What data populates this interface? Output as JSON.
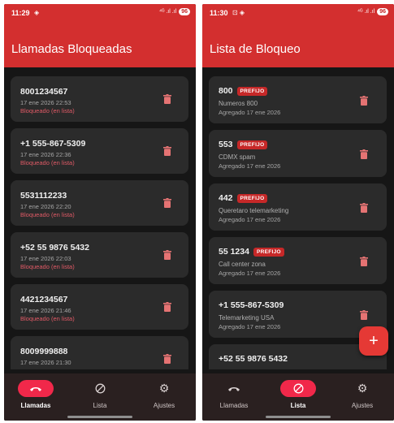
{
  "colors": {
    "header": "#d32f2f",
    "accent": "#f1284a",
    "background": "#161616",
    "card": "#2b2b2b",
    "status_red": "#e05a66"
  },
  "left": {
    "status": {
      "time": "11:29",
      "icons": "◈",
      "signal": "⁴ᴳ .ıl .ıl",
      "battery": "96"
    },
    "title": "Llamadas Bloqueadas",
    "calls": [
      {
        "number": "8001234567",
        "date": "17 ene 2026 22:53",
        "status": "Bloqueado (en lista)"
      },
      {
        "number": "+1 555-867-5309",
        "date": "17 ene 2026 22:36",
        "status": "Bloqueado (en lista)"
      },
      {
        "number": "5531112233",
        "date": "17 ene 2026 22:20",
        "status": "Bloqueado (en lista)"
      },
      {
        "number": "+52 55 9876 5432",
        "date": "17 ene 2026 22:03",
        "status": "Bloqueado (en lista)"
      },
      {
        "number": "4421234567",
        "date": "17 ene 2026 21:46",
        "status": "Bloqueado (en lista)"
      },
      {
        "number": "8009999888",
        "date": "17 ene 2026 21:30",
        "status": ""
      }
    ],
    "nav": [
      {
        "label": "Llamadas",
        "icon": "phone-hangup-icon"
      },
      {
        "label": "Lista",
        "icon": "block-icon"
      },
      {
        "label": "Ajustes",
        "icon": "gear-icon"
      }
    ],
    "nav_active": 0
  },
  "right": {
    "status": {
      "time": "11:30",
      "icons": "⊡ ◈",
      "signal": "⁴ᴳ .ıl .ıl",
      "battery": "96"
    },
    "title": "Lista de Bloqueo",
    "entries": [
      {
        "number": "800",
        "badge": "PREFIJO",
        "label": "Numeros 800",
        "added": "Agregado 17 ene 2026"
      },
      {
        "number": "553",
        "badge": "PREFIJO",
        "label": "CDMX spam",
        "added": "Agregado 17 ene 2026"
      },
      {
        "number": "442",
        "badge": "PREFIJO",
        "label": "Queretaro telemarketing",
        "added": "Agregado 17 ene 2026"
      },
      {
        "number": "55 1234",
        "badge": "PREFIJO",
        "label": "Call center zona",
        "added": "Agregado 17 ene 2026"
      },
      {
        "number": "+1 555-867-5309",
        "badge": "",
        "label": "Telemarketing USA",
        "added": "Agregado 17 ene 2026"
      },
      {
        "number": "+52 55 9876 5432",
        "badge": "",
        "label": "",
        "added": ""
      }
    ],
    "fab_label": "+",
    "nav": [
      {
        "label": "Llamadas",
        "icon": "phone-hangup-icon"
      },
      {
        "label": "Lista",
        "icon": "block-icon"
      },
      {
        "label": "Ajustes",
        "icon": "gear-icon"
      }
    ],
    "nav_active": 1
  }
}
